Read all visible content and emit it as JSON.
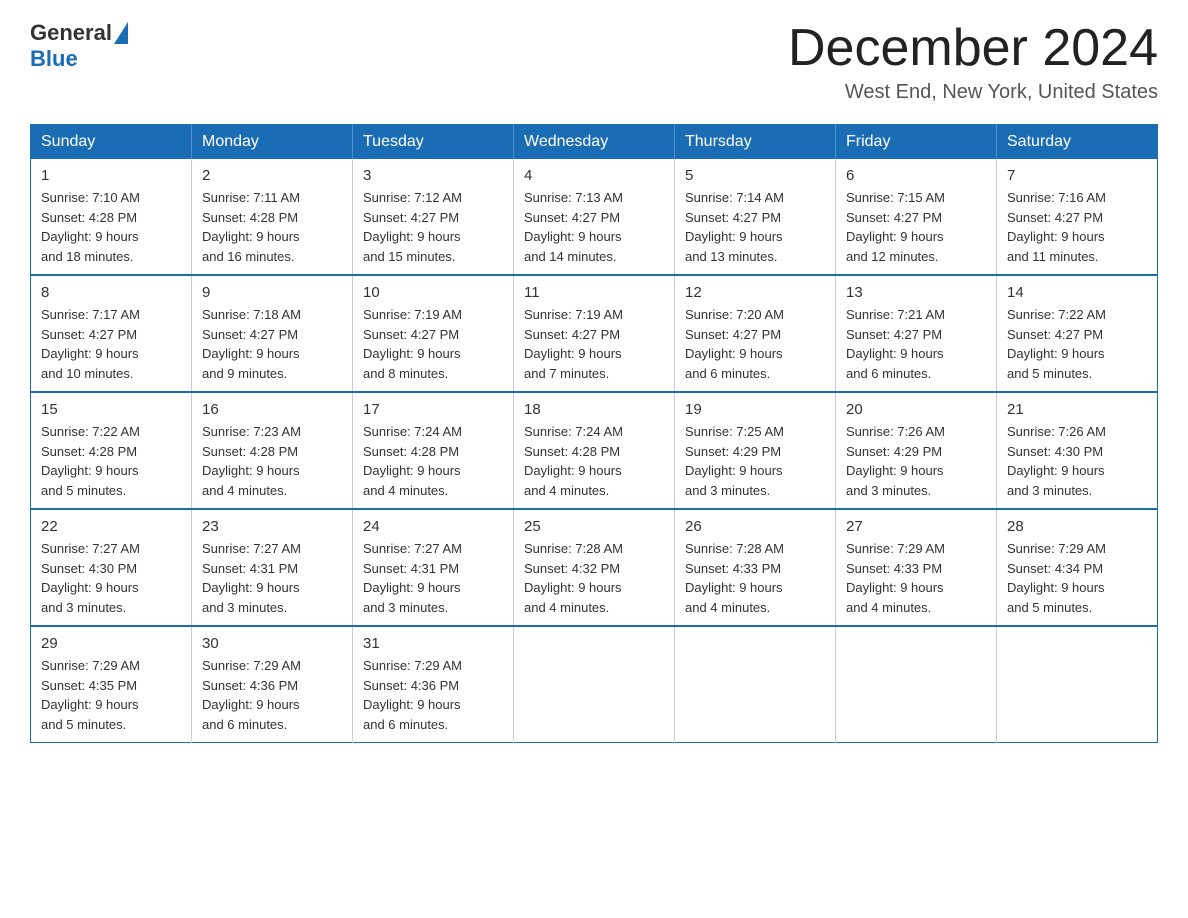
{
  "header": {
    "logo_general": "General",
    "logo_blue": "Blue",
    "month_title": "December 2024",
    "subtitle": "West End, New York, United States"
  },
  "days_of_week": [
    "Sunday",
    "Monday",
    "Tuesday",
    "Wednesday",
    "Thursday",
    "Friday",
    "Saturday"
  ],
  "weeks": [
    [
      {
        "day": "1",
        "sunrise": "7:10 AM",
        "sunset": "4:28 PM",
        "daylight": "9 hours and 18 minutes."
      },
      {
        "day": "2",
        "sunrise": "7:11 AM",
        "sunset": "4:28 PM",
        "daylight": "9 hours and 16 minutes."
      },
      {
        "day": "3",
        "sunrise": "7:12 AM",
        "sunset": "4:27 PM",
        "daylight": "9 hours and 15 minutes."
      },
      {
        "day": "4",
        "sunrise": "7:13 AM",
        "sunset": "4:27 PM",
        "daylight": "9 hours and 14 minutes."
      },
      {
        "day": "5",
        "sunrise": "7:14 AM",
        "sunset": "4:27 PM",
        "daylight": "9 hours and 13 minutes."
      },
      {
        "day": "6",
        "sunrise": "7:15 AM",
        "sunset": "4:27 PM",
        "daylight": "9 hours and 12 minutes."
      },
      {
        "day": "7",
        "sunrise": "7:16 AM",
        "sunset": "4:27 PM",
        "daylight": "9 hours and 11 minutes."
      }
    ],
    [
      {
        "day": "8",
        "sunrise": "7:17 AM",
        "sunset": "4:27 PM",
        "daylight": "9 hours and 10 minutes."
      },
      {
        "day": "9",
        "sunrise": "7:18 AM",
        "sunset": "4:27 PM",
        "daylight": "9 hours and 9 minutes."
      },
      {
        "day": "10",
        "sunrise": "7:19 AM",
        "sunset": "4:27 PM",
        "daylight": "9 hours and 8 minutes."
      },
      {
        "day": "11",
        "sunrise": "7:19 AM",
        "sunset": "4:27 PM",
        "daylight": "9 hours and 7 minutes."
      },
      {
        "day": "12",
        "sunrise": "7:20 AM",
        "sunset": "4:27 PM",
        "daylight": "9 hours and 6 minutes."
      },
      {
        "day": "13",
        "sunrise": "7:21 AM",
        "sunset": "4:27 PM",
        "daylight": "9 hours and 6 minutes."
      },
      {
        "day": "14",
        "sunrise": "7:22 AM",
        "sunset": "4:27 PM",
        "daylight": "9 hours and 5 minutes."
      }
    ],
    [
      {
        "day": "15",
        "sunrise": "7:22 AM",
        "sunset": "4:28 PM",
        "daylight": "9 hours and 5 minutes."
      },
      {
        "day": "16",
        "sunrise": "7:23 AM",
        "sunset": "4:28 PM",
        "daylight": "9 hours and 4 minutes."
      },
      {
        "day": "17",
        "sunrise": "7:24 AM",
        "sunset": "4:28 PM",
        "daylight": "9 hours and 4 minutes."
      },
      {
        "day": "18",
        "sunrise": "7:24 AM",
        "sunset": "4:28 PM",
        "daylight": "9 hours and 4 minutes."
      },
      {
        "day": "19",
        "sunrise": "7:25 AM",
        "sunset": "4:29 PM",
        "daylight": "9 hours and 3 minutes."
      },
      {
        "day": "20",
        "sunrise": "7:26 AM",
        "sunset": "4:29 PM",
        "daylight": "9 hours and 3 minutes."
      },
      {
        "day": "21",
        "sunrise": "7:26 AM",
        "sunset": "4:30 PM",
        "daylight": "9 hours and 3 minutes."
      }
    ],
    [
      {
        "day": "22",
        "sunrise": "7:27 AM",
        "sunset": "4:30 PM",
        "daylight": "9 hours and 3 minutes."
      },
      {
        "day": "23",
        "sunrise": "7:27 AM",
        "sunset": "4:31 PM",
        "daylight": "9 hours and 3 minutes."
      },
      {
        "day": "24",
        "sunrise": "7:27 AM",
        "sunset": "4:31 PM",
        "daylight": "9 hours and 3 minutes."
      },
      {
        "day": "25",
        "sunrise": "7:28 AM",
        "sunset": "4:32 PM",
        "daylight": "9 hours and 4 minutes."
      },
      {
        "day": "26",
        "sunrise": "7:28 AM",
        "sunset": "4:33 PM",
        "daylight": "9 hours and 4 minutes."
      },
      {
        "day": "27",
        "sunrise": "7:29 AM",
        "sunset": "4:33 PM",
        "daylight": "9 hours and 4 minutes."
      },
      {
        "day": "28",
        "sunrise": "7:29 AM",
        "sunset": "4:34 PM",
        "daylight": "9 hours and 5 minutes."
      }
    ],
    [
      {
        "day": "29",
        "sunrise": "7:29 AM",
        "sunset": "4:35 PM",
        "daylight": "9 hours and 5 minutes."
      },
      {
        "day": "30",
        "sunrise": "7:29 AM",
        "sunset": "4:36 PM",
        "daylight": "9 hours and 6 minutes."
      },
      {
        "day": "31",
        "sunrise": "7:29 AM",
        "sunset": "4:36 PM",
        "daylight": "9 hours and 6 minutes."
      },
      null,
      null,
      null,
      null
    ]
  ]
}
